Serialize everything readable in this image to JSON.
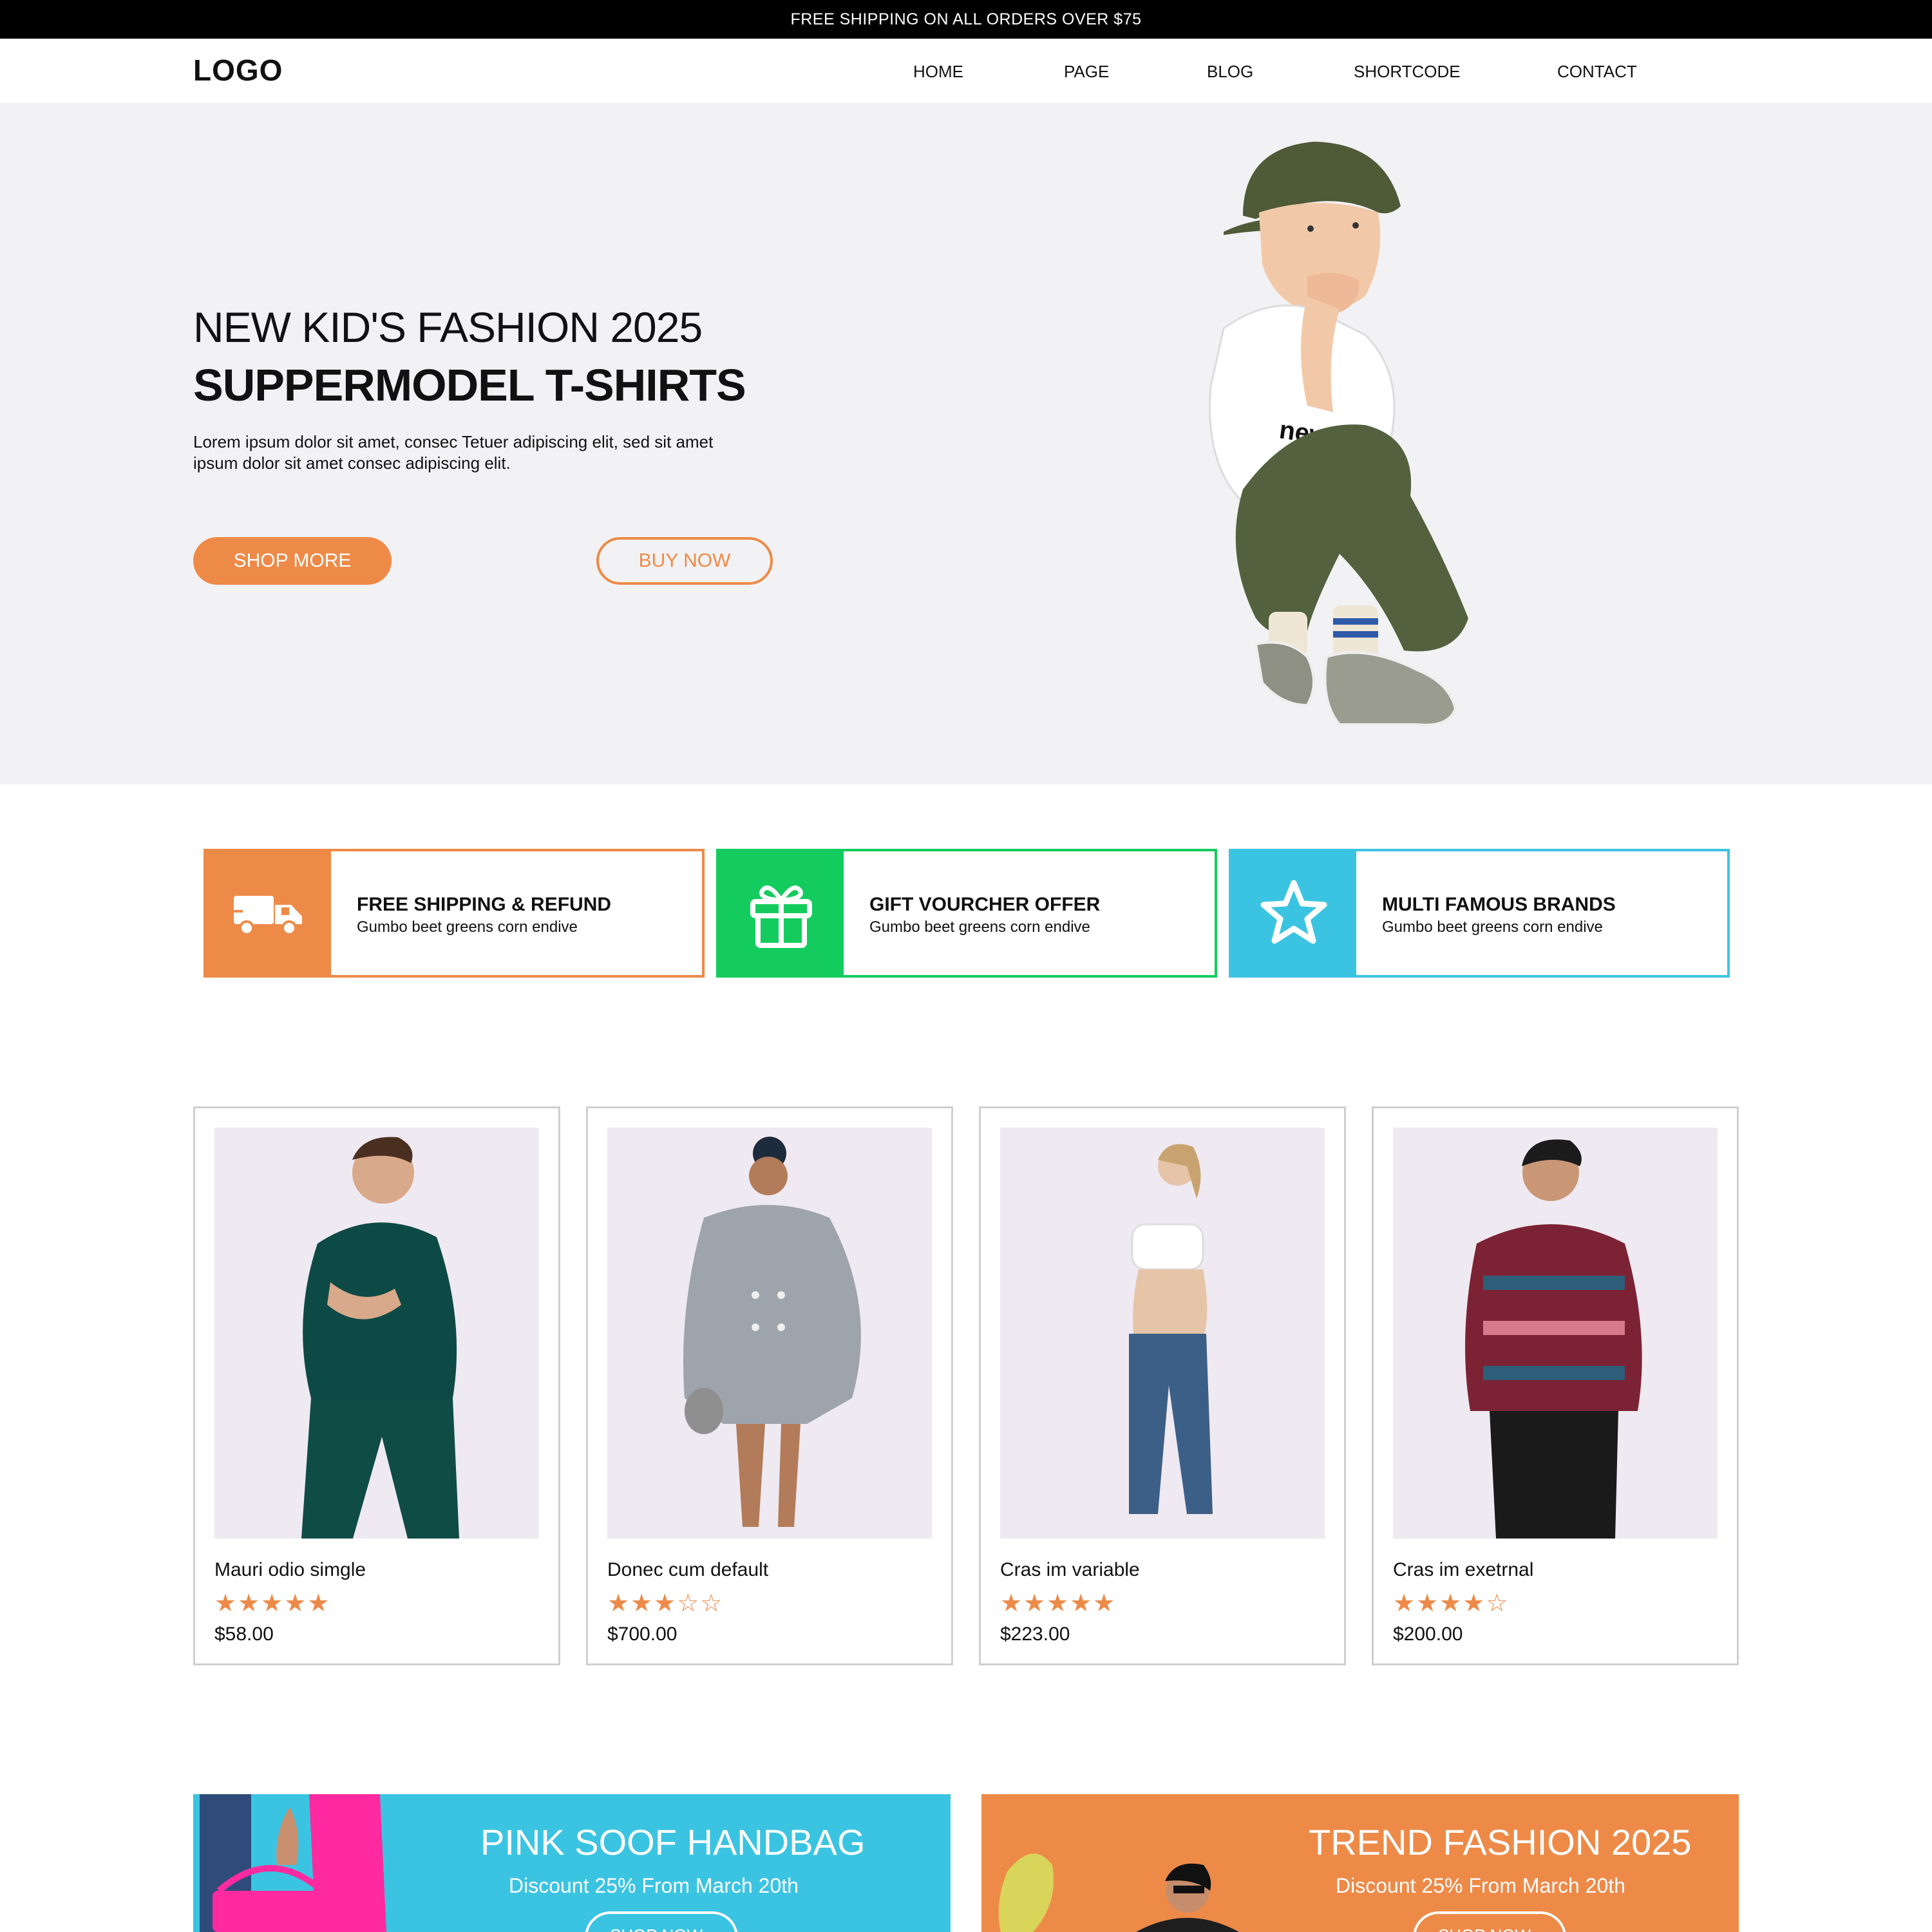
{
  "announcement": "FREE SHIPPING ON ALL ORDERS OVER $75",
  "header": {
    "logo": "LOGO",
    "nav": [
      "HOME",
      "PAGE",
      "BLOG",
      "SHORTCODE",
      "CONTACT"
    ]
  },
  "hero": {
    "kicker": "NEW KID'S FASHION 2025",
    "title": "SUPPERMODEL T-SHIRTS",
    "description": "Lorem ipsum dolor sit amet, consec Tetuer adipiscing elit, sed sit amet ipsum dolor sit amet consec adipiscing elit.",
    "shop_more": "SHOP MORE",
    "buy_now": "BUY NOW"
  },
  "features": [
    {
      "title": "FREE SHIPPING & REFUND",
      "subtitle": "Gumbo beet greens corn endive",
      "icon": "truck-icon",
      "color": "#ee8a48"
    },
    {
      "title": "GIFT VOURCHER OFFER",
      "subtitle": "Gumbo beet greens corn endive",
      "icon": "gift-icon",
      "color": "#14cc5e"
    },
    {
      "title": "MULTI FAMOUS BRANDS",
      "subtitle": "Gumbo beet greens corn endive",
      "icon": "star-icon",
      "color": "#3bc4e2"
    }
  ],
  "products": [
    {
      "name": "Mauri odio simgle",
      "rating": 5,
      "stars": "★★★★★",
      "price": "$58.00"
    },
    {
      "name": "Donec cum default",
      "rating": 3,
      "stars": "★★★☆☆",
      "price": "$700.00"
    },
    {
      "name": "Cras im variable",
      "rating": 5,
      "stars": "★★★★★",
      "price": "$223.00"
    },
    {
      "name": "Cras im exetrnal",
      "rating": 4,
      "stars": "★★★★☆",
      "price": "$200.00"
    }
  ],
  "banners": [
    {
      "title": "PINK SOOF HANDBAG",
      "subtitle": "Discount 25% From March 20th",
      "button": "SHOP NOW ›",
      "color": "#3bc4e2"
    },
    {
      "title": "TREND FASHION 2025",
      "subtitle": "Discount 25% From March 20th",
      "button": "SHOP NOW ›",
      "color": "#ee8a48"
    }
  ],
  "colors": {
    "accent": "#ee8a48",
    "hero_bg": "#f2f2f4",
    "card_img_bg": "#efe9f1"
  }
}
